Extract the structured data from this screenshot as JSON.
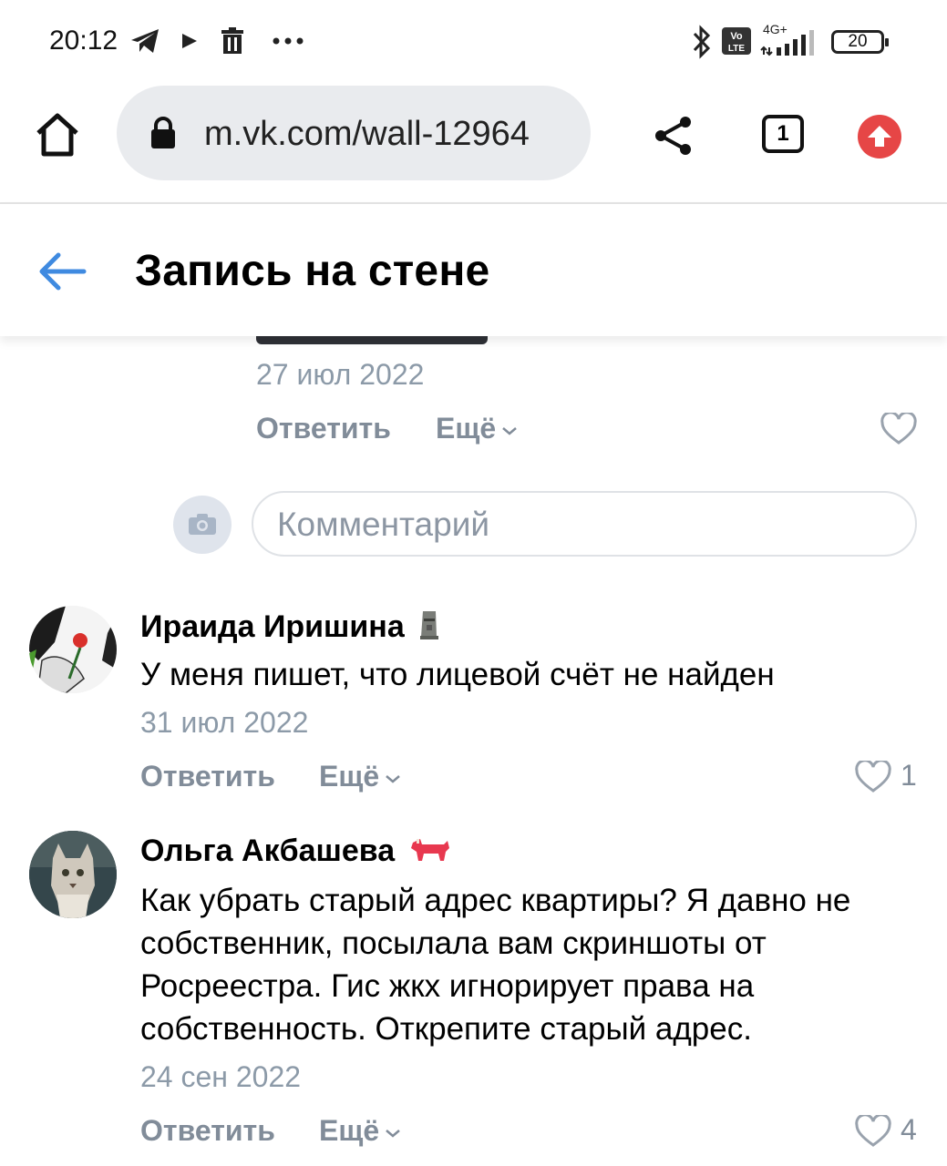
{
  "status_bar": {
    "time": "20:12",
    "battery": "20",
    "network": "4G+"
  },
  "browser": {
    "url": "m.vk.com/wall-12964",
    "tab_count": "1"
  },
  "page": {
    "title": "Запись на стене"
  },
  "first_comment_meta": {
    "date": "27 июл 2022",
    "reply_label": "Ответить",
    "more_label": "Ещё"
  },
  "comment_input": {
    "placeholder": "Комментарий"
  },
  "comments": [
    {
      "author": "Ираида Иришина",
      "text": "У меня пишет, что лицевой счёт не найден",
      "date": "31 июл 2022",
      "reply_label": "Ответить",
      "more_label": "Ещё",
      "likes": "1"
    },
    {
      "author": "Ольга Акбашева",
      "text": "Как убрать старый адрес квартиры? Я давно не собственник, посылала вам скриншоты от Росреестра. Гис жкх игнорирует права на собственность. Открепите старый адрес.",
      "date": "24 сен 2022",
      "reply_label": "Ответить",
      "more_label": "Ещё",
      "likes": "4"
    }
  ],
  "colors": {
    "accent": "#3f8ae0",
    "secondary_text": "#818c99",
    "upload_red": "#e64646"
  }
}
